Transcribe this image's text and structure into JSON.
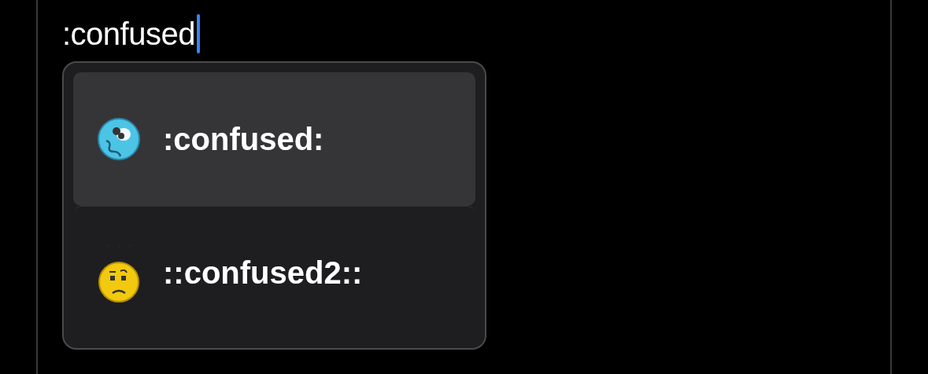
{
  "input": {
    "value": ":confused"
  },
  "suggestions": [
    {
      "kind": "spiral",
      "label": ":confused:",
      "selected": true
    },
    {
      "kind": "puzzled",
      "label": "::confused2::",
      "selected": false
    }
  ]
}
